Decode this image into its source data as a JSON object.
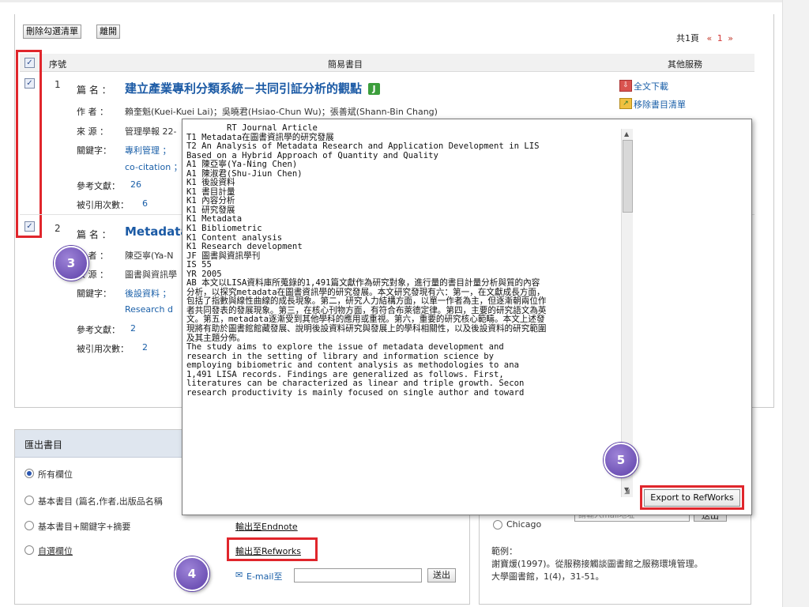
{
  "toolbar": {
    "delete_label": "刪除勾選清單",
    "leave_label": "離開"
  },
  "pager": {
    "total": "共1頁",
    "prev": "«",
    "current": "1",
    "next": "»"
  },
  "table_header": {
    "seq": "序號",
    "biblio": "簡易書目",
    "services": "其他服務"
  },
  "checkmark": "✓",
  "records": [
    {
      "num": "1",
      "title_label": "篇 名 ：",
      "title": "建立產業專利分類系統－共同引証分析的觀點",
      "badge": "J",
      "author_label": "作 者 ：",
      "authors": "賴奎魁(Kuei-Kuei Lai)；吳曉君(Hsiao-Chun Wu)；張善斌(Shann-Bin Chang)",
      "source_label": "來 源 ：",
      "source": "管理學報 22-",
      "keyword_label": "關鍵字：",
      "keyword1": "專利管理 ；",
      "keyword2": "co-citation ；",
      "refs_label": "參考文獻：",
      "refs": "26",
      "cited_label": "被引用次數：",
      "cited": "6"
    },
    {
      "num": "2",
      "title_label": "篇 名 ：",
      "title": "Metadata",
      "author_label": "作 者 ：",
      "authors": "陳亞寧(Ya-N",
      "source_label": "來 源 ：",
      "source": "圖書與資訊學",
      "keyword_label": "關鍵字：",
      "keyword1": "後設資料 ；",
      "keyword2": "Research d",
      "refs_label": "參考文獻：",
      "refs": "2",
      "cited_label": "被引用次數：",
      "cited": "2"
    }
  ],
  "services": {
    "fulltext": "全文下載",
    "remove": "移除書目清單"
  },
  "popup": {
    "text": "        RT Journal Article\nT1 Metadata在圖書資訊學的研究發展\nT2 An Analysis of Metadata Research and Application Development in LIS\nBased on a Hybrid Approach of Quantity and Quality\nA1 陳亞寧(Ya-Ning Chen)\nA1 陳淑君(Shu-Jiun Chen)\nK1 後設資料\nK1 書目計量\nK1 內容分析\nK1 研究發展\nK1 Metadata\nK1 Bibliometric\nK1 Content analysis\nK1 Research development\nJF 圖書與資訊學刊\nIS 55\nYR 2005\nAB 本文以LISA資料庫所蒐錄的1,491篇文獻作為研究對象，進行量的書目計量分析與質的內容\n分析，以探究metadata在圖書資訊學的研究發展。本文研究發現有六：第一，在文獻成長方面，\n包括了指數與線性曲線的成長現象。第二，研究人力結構方面，以單一作者為主，但逐漸朝兩位作\n者共同發表的發展現象。第三，在核心刊物方面，有符合布萊德定律。第四，主要的研究語文為英\n文。第五，metadata逐漸受到其他學科的應用或重視。第六，重要的研究核心範疇。本文上述發\n現將有助於圖書館館藏發展、說明後設資料研究與發展上的學科相關性，以及後設資料的研究範圍\n及其主題分佈。\nThe study aims to explore the issue of metadata development and\nresearch in the setting of library and information science by\nemploying bibiometric and content analysis as methodologies to ana\n1,491 LISA records. Findings are generalized as follows. First,\nliteratures can be characterized as linear and triple growth. Secon\nresearch productivity is mainly focused on single author and toward",
    "export_label": "Export to RefWorks"
  },
  "export": {
    "heading": "匯出書目",
    "opt_all": "所有欄位",
    "opt_basic": "基本書目 (篇名,作者,出版品名稱",
    "opt_basic_kw": "基本書目+關鍵字+摘要",
    "opt_custom": "自選欄位",
    "endnote": "輸出至Endnote",
    "refworks": "輸出至Refworks",
    "email_label": "E-mail至",
    "send": "送出"
  },
  "citation": {
    "chicago": "Chicago",
    "email_placeholder": "請輸入mail地址",
    "send": "送出",
    "example_label": "範例：",
    "example_line1": "謝寶煖(1997)。從服務接觸談圖書館之服務環境管理。",
    "example_line2": "大學圖書館，1(4)，31-51。"
  },
  "steps": {
    "s3": "3",
    "s4": "4",
    "s5": "5"
  },
  "colors": {
    "accent_red": "#e0262c",
    "link_blue": "#1a5fa8",
    "step_purple": "#5c3fa8"
  }
}
